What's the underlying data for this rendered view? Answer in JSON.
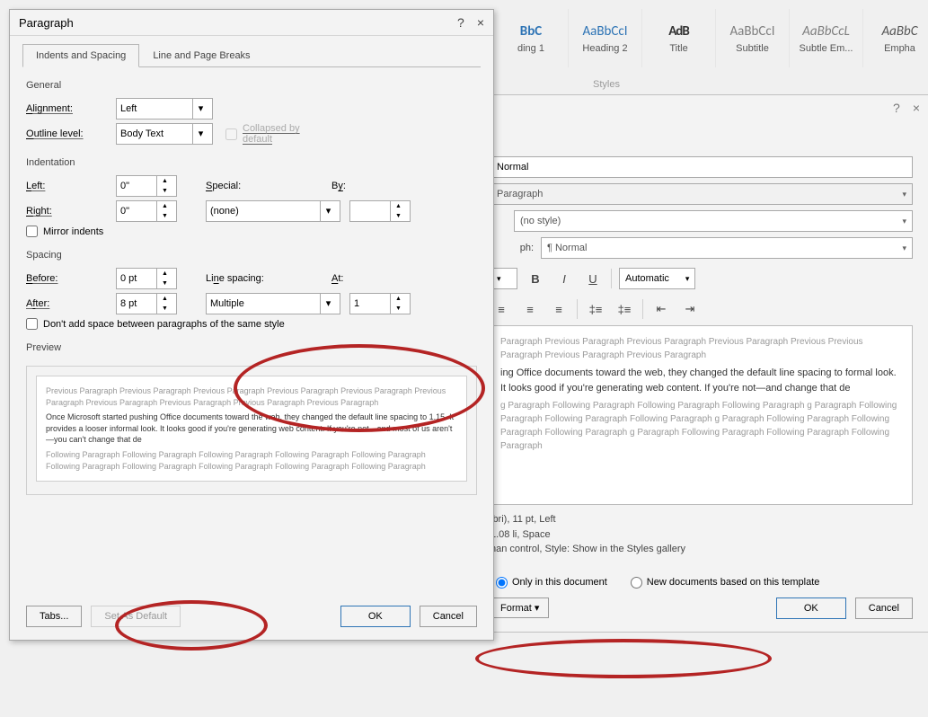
{
  "ribbon": {
    "styles": [
      {
        "preview": "BbC",
        "label": "ding 1",
        "cls": "p-h1"
      },
      {
        "preview": "AaBbCcI",
        "label": "Heading 2",
        "cls": "p-h2"
      },
      {
        "preview": "AdB",
        "label": "Title",
        "cls": "p-title"
      },
      {
        "preview": "AaBbCcI",
        "label": "Subtitle",
        "cls": "p-sub"
      },
      {
        "preview": "AaBbCcL",
        "label": "Subtle Em...",
        "cls": "p-subem"
      },
      {
        "preview": "AaBbC",
        "label": "Empha",
        "cls": "p-emph"
      }
    ],
    "section": "Styles"
  },
  "paragraph": {
    "title": "Paragraph",
    "help": "?",
    "close": "×",
    "tabs": {
      "indents": "Indents and Spacing",
      "breaks": "Line and Page Breaks"
    },
    "general": "General",
    "alignment_label": "Alignment:",
    "alignment_value": "Left",
    "outline_label": "Outline level:",
    "outline_value": "Body Text",
    "collapsed": "Collapsed by default",
    "indentation": "Indentation",
    "left_label": "Left:",
    "left_value": "0\"",
    "right_label": "Right:",
    "right_value": "0\"",
    "special_label": "Special:",
    "special_value": "(none)",
    "by_label": "By:",
    "by_value": "",
    "mirror": "Mirror indents",
    "spacing": "Spacing",
    "before_label": "Before:",
    "before_value": "0 pt",
    "after_label": "After:",
    "after_value": "8 pt",
    "line_spacing_label": "Line spacing:",
    "line_spacing_value": "Multiple",
    "at_label": "At:",
    "at_value": "1",
    "dont_add": "Don't add space between paragraphs of the same style",
    "preview_label": "Preview",
    "preview_faint": "Previous Paragraph Previous Paragraph Previous Paragraph Previous Paragraph Previous Paragraph Previous Paragraph Previous Paragraph Previous Paragraph Previous Paragraph Previous Paragraph",
    "preview_body": "Once Microsoft started pushing Office documents toward the web, they changed the default line spacing to 1.15. It provides a looser informal look. It looks good if you're generating web content. If you're not—and most of us aren't—you can't change that de",
    "preview_following": "Following Paragraph Following Paragraph Following Paragraph Following Paragraph Following Paragraph Following Paragraph Following Paragraph Following Paragraph Following Paragraph Following Paragraph",
    "tabs_btn": "Tabs...",
    "set_default": "Set As Default",
    "ok": "OK",
    "cancel": "Cancel"
  },
  "modify": {
    "help": "?",
    "close": "×",
    "name_value": "Normal",
    "type_value": "Paragraph",
    "based_value": "(no style)",
    "follow_label": "ph:",
    "follow_value": "¶ Normal",
    "font_value": "",
    "size_value": "",
    "bold": "B",
    "italic": "I",
    "underline": "U",
    "color_value": "Automatic",
    "preview_faint": "Paragraph Previous Paragraph Previous Paragraph Previous Paragraph Previous Previous Paragraph Previous Paragraph Previous Paragraph",
    "preview_body": "ing Office documents toward the web, they changed the default line spacing to formal look. It looks good if you're generating web content. If you're not—and change that de",
    "preview_following": "g Paragraph Following Paragraph Following Paragraph Following Paragraph g Paragraph Following Paragraph Following Paragraph Following Paragraph g Paragraph Following Paragraph Following Paragraph Following Paragraph g Paragraph Following Paragraph Following Paragraph Following Paragraph",
    "desc1": "ibri), 11 pt, Left",
    "desc2": "1.08 li, Space",
    "desc3": "han control, Style: Show in the Styles gallery",
    "radio_this": "Only in this document",
    "radio_template": "New documents based on this template",
    "format": "Format ▾",
    "ok": "OK",
    "cancel": "Cancel"
  }
}
